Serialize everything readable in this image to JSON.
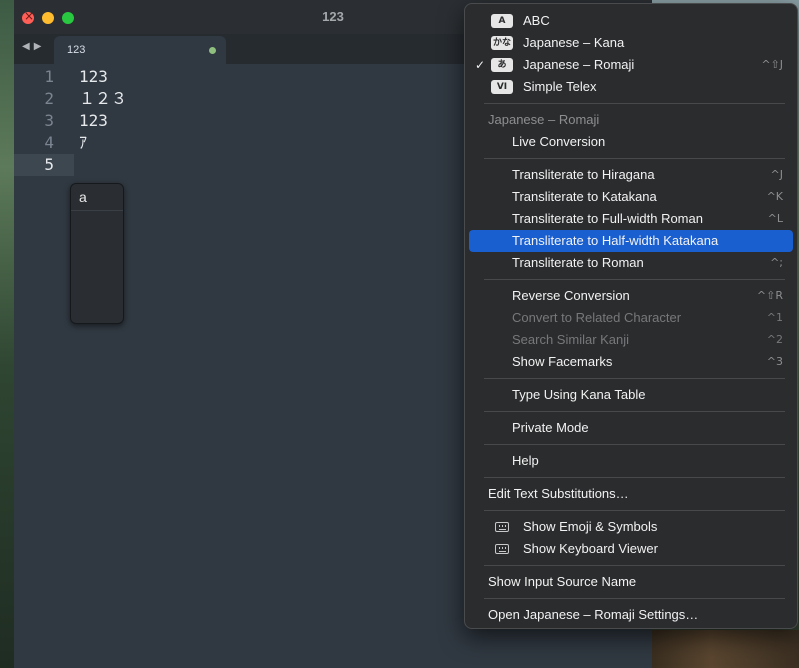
{
  "window": {
    "title": "123",
    "tab_label": "123"
  },
  "editor": {
    "line_numbers": [
      "1",
      "2",
      "3",
      "4",
      "5"
    ],
    "lines": [
      "123",
      "１２３",
      "123",
      "ｱ",
      ""
    ],
    "current_line": "5"
  },
  "candidate_popup": {
    "items": [
      "a"
    ]
  },
  "input_menu": {
    "sources": [
      {
        "badge": "A",
        "label": "ABC",
        "checked": false
      },
      {
        "badge": "かな",
        "label": "Japanese – Kana",
        "checked": false
      },
      {
        "badge": "あ",
        "label": "Japanese – Romaji",
        "checked": true,
        "shortcut": "^⇧J"
      },
      {
        "badge": "VI",
        "label": "Simple Telex",
        "checked": false
      }
    ],
    "section_header": "Japanese – Romaji",
    "live_conversion": "Live Conversion",
    "transliterate": [
      {
        "label": "Transliterate to Hiragana",
        "shortcut": "^J"
      },
      {
        "label": "Transliterate to Katakana",
        "shortcut": "^K"
      },
      {
        "label": "Transliterate to Full-width Roman",
        "shortcut": "^L"
      },
      {
        "label": "Transliterate to Half-width Katakana",
        "shortcut": "",
        "highlighted": true
      },
      {
        "label": "Transliterate to Roman",
        "shortcut": "^;"
      }
    ],
    "conversion": [
      {
        "label": "Reverse Conversion",
        "shortcut": "^⇧R",
        "disabled": false
      },
      {
        "label": "Convert to Related Character",
        "shortcut": "^1",
        "disabled": true
      },
      {
        "label": "Search Similar Kanji",
        "shortcut": "^2",
        "disabled": true
      },
      {
        "label": "Show Facemarks",
        "shortcut": "^3",
        "disabled": false
      }
    ],
    "kana_table": "Type Using Kana Table",
    "private_mode": "Private Mode",
    "help": "Help",
    "edit_text_substitutions": "Edit Text Substitutions…",
    "show_emoji": "Show Emoji & Symbols",
    "show_keyboard_viewer": "Show Keyboard Viewer",
    "show_input_source_name": "Show Input Source Name",
    "open_settings": "Open Japanese – Romaji Settings…"
  }
}
